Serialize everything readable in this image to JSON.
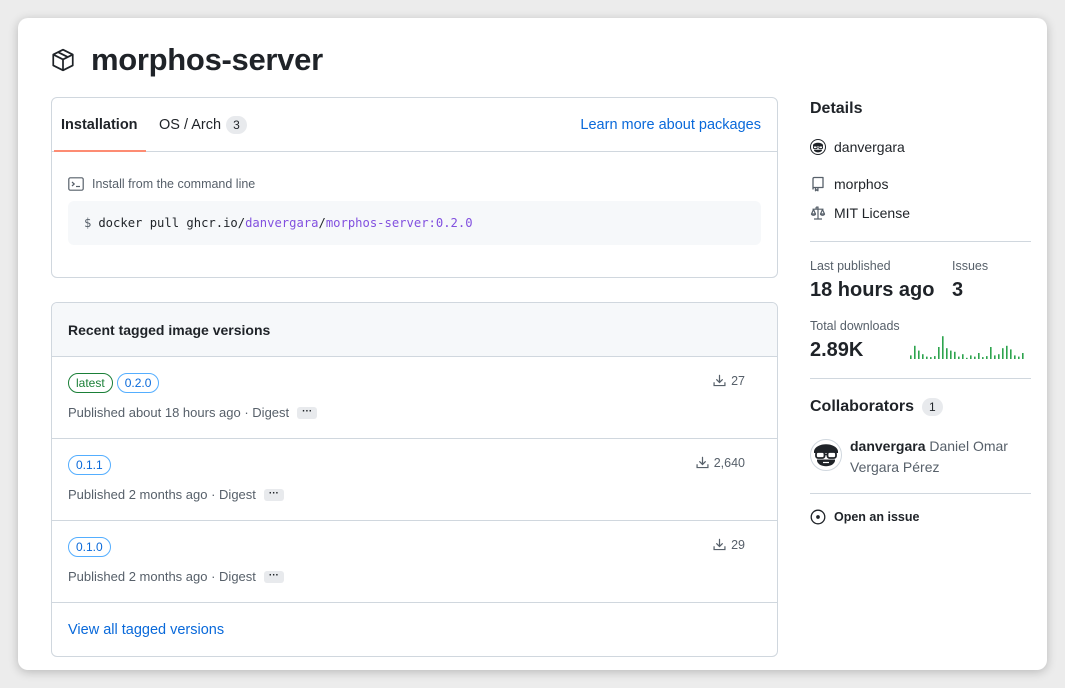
{
  "package": {
    "name": "morphos-server"
  },
  "install": {
    "tabs": [
      {
        "label": "Installation"
      },
      {
        "label": "OS / Arch",
        "count": "3"
      }
    ],
    "learn_more": "Learn more about packages",
    "command_label": "Install from the command line",
    "command": {
      "prompt": "$",
      "prefix": "docker pull ghcr.io/",
      "owner": "danvergara",
      "slash": "/",
      "image": "morphos-server:0.2.0"
    }
  },
  "versions": {
    "title": "Recent tagged image versions",
    "rows": [
      {
        "tags": [
          "latest",
          "0.2.0"
        ],
        "published": "Published about 18 hours ago · Digest",
        "downloads": "27"
      },
      {
        "tags": [
          "0.1.1"
        ],
        "published": "Published 2 months ago · Digest",
        "downloads": "2,640"
      },
      {
        "tags": [
          "0.1.0"
        ],
        "published": "Published 2 months ago · Digest",
        "downloads": "29"
      }
    ],
    "more_label": "···",
    "view_all": "View all tagged versions"
  },
  "details": {
    "title": "Details",
    "owner": "danvergara",
    "repo": "morphos",
    "license": "MIT License",
    "last_published_label": "Last published",
    "last_published": "18 hours ago",
    "issues_label": "Issues",
    "issues": "3",
    "downloads_label": "Total downloads",
    "downloads": "2.89K",
    "sparkline": [
      0.15,
      0.55,
      0.35,
      0.2,
      0.1,
      0.08,
      0.12,
      0.5,
      0.95,
      0.45,
      0.35,
      0.3,
      0.1,
      0.2,
      0.05,
      0.15,
      0.1,
      0.25,
      0.08,
      0.12,
      0.5,
      0.15,
      0.2,
      0.45,
      0.55,
      0.4,
      0.15,
      0.1,
      0.25
    ],
    "accent": "#2da44e"
  },
  "collaborators": {
    "title": "Collaborators",
    "count": "1",
    "user": "danvergara",
    "full_name": "Daniel Omar Vergara Pérez"
  },
  "open_issue": "Open an issue"
}
